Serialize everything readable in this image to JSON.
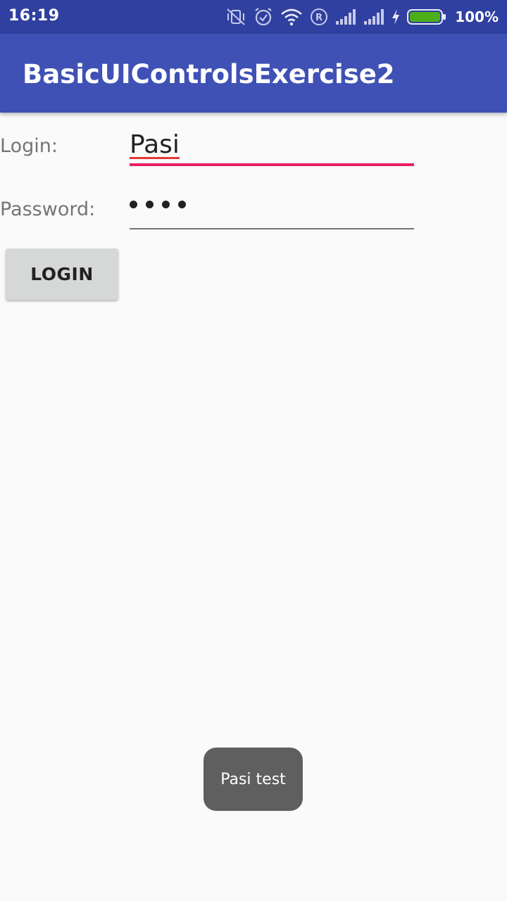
{
  "status_bar": {
    "time": "16:19",
    "battery_percent": "100%",
    "icons": [
      "vibrate-off-icon",
      "alarm-icon",
      "wifi-icon",
      "roaming-icon",
      "signal-icon",
      "signal-icon",
      "charging-icon",
      "battery-icon"
    ],
    "battery_level": 1.0,
    "battery_color": "#4caf1a"
  },
  "app_bar": {
    "title": "BasicUIControlsExercise2",
    "color": "#3f51b5"
  },
  "form": {
    "login_label": "Login:",
    "login_value": "Pasi",
    "password_label": "Password:",
    "password_mask_count": 4,
    "login_button_label": "LOGIN",
    "accent_color": "#e91e63"
  },
  "toast": {
    "text": "Pasi test"
  }
}
